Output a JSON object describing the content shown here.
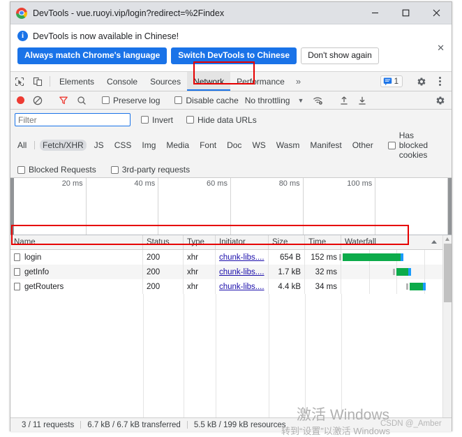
{
  "window": {
    "title": "DevTools - vue.ruoyi.vip/login?redirect=%2Findex",
    "logo_icon": "chrome-logo",
    "controls": {
      "minimize": "—",
      "maximize": "☐",
      "close": "✕"
    }
  },
  "banner": {
    "icon": "info-icon",
    "message": "DevTools is now available in Chinese!",
    "buttons": [
      {
        "label": "Always match Chrome's language",
        "style": "primary"
      },
      {
        "label": "Switch DevTools to Chinese",
        "style": "primary"
      },
      {
        "label": "Don't show again",
        "style": "secondary"
      }
    ],
    "close_label": "✕"
  },
  "tabstrip": {
    "left_icons": [
      "inspect-element-icon",
      "device-toolbar-icon"
    ],
    "tabs": [
      {
        "label": "Elements",
        "active": false
      },
      {
        "label": "Console",
        "active": false
      },
      {
        "label": "Sources",
        "active": false
      },
      {
        "label": "Network",
        "active": true
      },
      {
        "label": "Performance",
        "active": false
      }
    ],
    "overflow_label": "»",
    "message_count": "1",
    "message_icon": "message-badge-icon",
    "settings_icon": "gear-icon",
    "more_icon": "kebab-menu-icon"
  },
  "network_toolbar": {
    "record_icon": "record-button-icon",
    "clear_icon": "clear-icon",
    "filter_icon": "filter-funnel-icon",
    "search_icon": "search-icon",
    "preserve_log": {
      "label": "Preserve log",
      "checked": false
    },
    "disable_cache": {
      "label": "Disable cache",
      "checked": false
    },
    "throttling": {
      "value": "No throttling",
      "caret": "▼"
    },
    "network_conditions_icon": "wifi-settings-icon",
    "import_icon": "import-har-icon",
    "export_icon": "export-har-icon",
    "settings_icon": "gear-icon"
  },
  "filterbar": {
    "filter_placeholder": "Filter",
    "filter_value": "",
    "invert": {
      "label": "Invert",
      "checked": false
    },
    "hide_data_urls": {
      "label": "Hide data URLs",
      "checked": false
    },
    "types": [
      {
        "label": "All",
        "selected": false
      },
      {
        "label": "Fetch/XHR",
        "selected": true
      },
      {
        "label": "JS",
        "selected": false
      },
      {
        "label": "CSS",
        "selected": false
      },
      {
        "label": "Img",
        "selected": false
      },
      {
        "label": "Media",
        "selected": false
      },
      {
        "label": "Font",
        "selected": false
      },
      {
        "label": "Doc",
        "selected": false
      },
      {
        "label": "WS",
        "selected": false
      },
      {
        "label": "Wasm",
        "selected": false
      },
      {
        "label": "Manifest",
        "selected": false
      },
      {
        "label": "Other",
        "selected": false
      }
    ],
    "has_blocked_cookies": {
      "label": "Has blocked cookies",
      "checked": false
    },
    "blocked_requests": {
      "label": "Blocked Requests",
      "checked": false
    },
    "third_party_requests": {
      "label": "3rd-party requests",
      "checked": false
    }
  },
  "overview": {
    "ticks": [
      "20 ms",
      "40 ms",
      "60 ms",
      "80 ms",
      "100 ms"
    ]
  },
  "table": {
    "columns": [
      "Name",
      "Status",
      "Type",
      "Initiator",
      "Size",
      "Time",
      "Waterfall"
    ],
    "sort_indicator": "▲",
    "rows": [
      {
        "name": "login",
        "status": "200",
        "type": "xhr",
        "initiator": "chunk-libs....",
        "size": "654 B",
        "time": "152 ms",
        "wf_start_pct": 1,
        "wf_width_pct": 53,
        "highlighted": true
      },
      {
        "name": "getInfo",
        "status": "200",
        "type": "xhr",
        "initiator": "chunk-libs....",
        "size": "1.7 kB",
        "time": "32 ms",
        "wf_start_pct": 50,
        "wf_width_pct": 11,
        "highlighted": false
      },
      {
        "name": "getRouters",
        "status": "200",
        "type": "xhr",
        "initiator": "chunk-libs....",
        "size": "4.4 kB",
        "time": "34 ms",
        "wf_start_pct": 62,
        "wf_width_pct": 12,
        "highlighted": false
      }
    ]
  },
  "statusbar": {
    "requests": "3 / 11 requests",
    "transferred": "6.7 kB / 6.7 kB transferred",
    "resources": "5.5 kB / 199 kB resources"
  },
  "watermark": {
    "title": "激活 Windows",
    "subtitle": "转到“设置”以激活 Windows",
    "credit": "CSDN @_Amber"
  },
  "colors": {
    "accent": "#1a73e8",
    "annotation": "#e60000",
    "waterfall_bar": "#0cab4a",
    "waterfall_tail": "#1a9bfc",
    "record_active": "#ee3b33"
  }
}
